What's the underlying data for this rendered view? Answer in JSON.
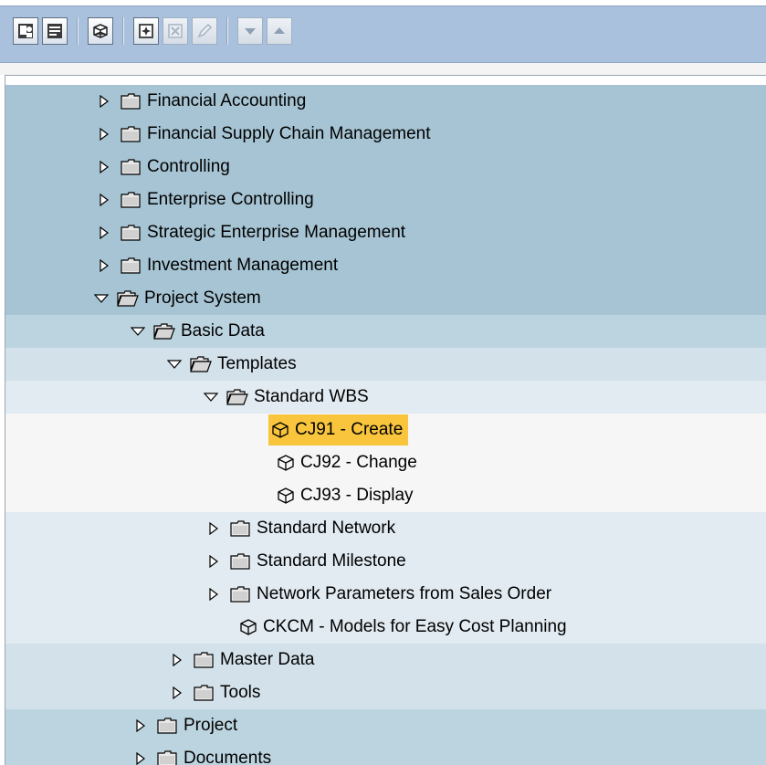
{
  "toolbar": {
    "buttons": [
      {
        "name": "user-menu-button",
        "icon": "user-menu-icon",
        "enabled": true
      },
      {
        "name": "sap-menu-button",
        "icon": "sap-menu-icon",
        "enabled": true
      },
      {
        "name": "other-menu-button",
        "icon": "other-menu-icon",
        "enabled": true
      },
      {
        "name": "add-favorites-button",
        "icon": "add-favorite-icon",
        "enabled": true
      },
      {
        "name": "delete-favorites-button",
        "icon": "delete-favorite-icon",
        "enabled": false
      },
      {
        "name": "change-favorites-button",
        "icon": "pencil-icon",
        "enabled": false
      },
      {
        "name": "move-down-button",
        "icon": "triangle-down-icon",
        "enabled": false
      },
      {
        "name": "move-up-button",
        "icon": "triangle-up-icon",
        "enabled": false
      }
    ]
  },
  "colors": {
    "toolbar_bg": "#a9c1dd",
    "level0": "#a6c4d3",
    "level1": "#bcd4e0",
    "level2": "#d3e1ea",
    "level3": "#e2ebf2",
    "level4": "#f6f6f6",
    "selected": "#f8c53c"
  },
  "tree": {
    "rows": [
      {
        "label": "Financial Accounting",
        "type": "folder",
        "state": "collapsed"
      },
      {
        "label": "Financial Supply Chain Management",
        "type": "folder",
        "state": "collapsed"
      },
      {
        "label": "Controlling",
        "type": "folder",
        "state": "collapsed"
      },
      {
        "label": "Enterprise Controlling",
        "type": "folder",
        "state": "collapsed"
      },
      {
        "label": "Strategic Enterprise Management",
        "type": "folder",
        "state": "collapsed"
      },
      {
        "label": "Investment Management",
        "type": "folder",
        "state": "collapsed"
      },
      {
        "label": "Project System",
        "type": "folder",
        "state": "expanded"
      },
      {
        "label": "Basic Data",
        "type": "folder",
        "state": "expanded"
      },
      {
        "label": "Templates",
        "type": "folder",
        "state": "expanded"
      },
      {
        "label": "Standard WBS",
        "type": "folder",
        "state": "expanded"
      },
      {
        "label": "CJ91 - Create",
        "type": "transaction",
        "selected": true
      },
      {
        "label": "CJ92 - Change",
        "type": "transaction"
      },
      {
        "label": "CJ93 - Display",
        "type": "transaction"
      },
      {
        "label": "Standard Network",
        "type": "folder",
        "state": "collapsed"
      },
      {
        "label": "Standard Milestone",
        "type": "folder",
        "state": "collapsed"
      },
      {
        "label": "Network Parameters from Sales Order",
        "type": "folder",
        "state": "collapsed"
      },
      {
        "label": "CKCM - Models for Easy Cost Planning",
        "type": "transaction"
      },
      {
        "label": "Master Data",
        "type": "folder",
        "state": "collapsed"
      },
      {
        "label": "Tools",
        "type": "folder",
        "state": "collapsed"
      },
      {
        "label": "Project",
        "type": "folder",
        "state": "collapsed"
      },
      {
        "label": "Documents",
        "type": "folder",
        "state": "collapsed"
      }
    ]
  }
}
